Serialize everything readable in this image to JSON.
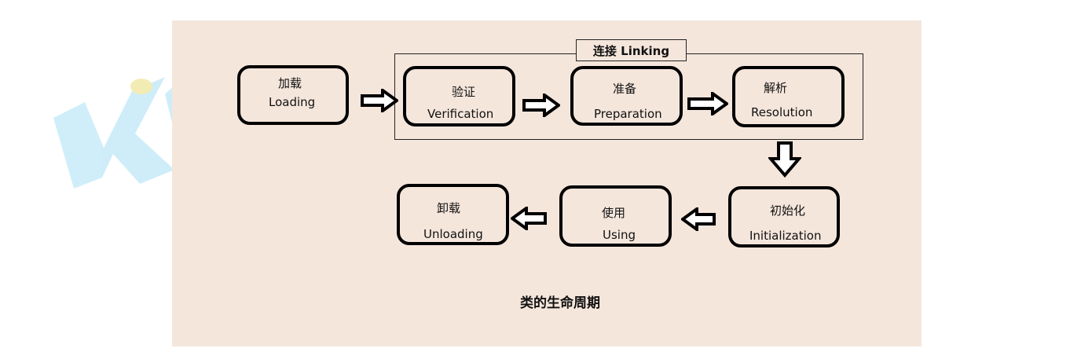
{
  "steps": {
    "loading": {
      "zh": "加载",
      "en": "Loading"
    },
    "verification": {
      "zh": "验证",
      "en": "Verification"
    },
    "preparation": {
      "zh": "准备",
      "en": "Preparation"
    },
    "resolution": {
      "zh": "解析",
      "en": "Resolution"
    },
    "initialization": {
      "zh": "初始化",
      "en": "Initialization"
    },
    "using": {
      "zh": "使用",
      "en": "Using"
    },
    "unloading": {
      "zh": "卸载",
      "en": "Unloading"
    }
  },
  "linking_label": "连接 Linking",
  "caption": "类的生命周期",
  "colors": {
    "panel": "#f5e6dc",
    "border": "#000000",
    "watermark": "#bfe6f7"
  }
}
